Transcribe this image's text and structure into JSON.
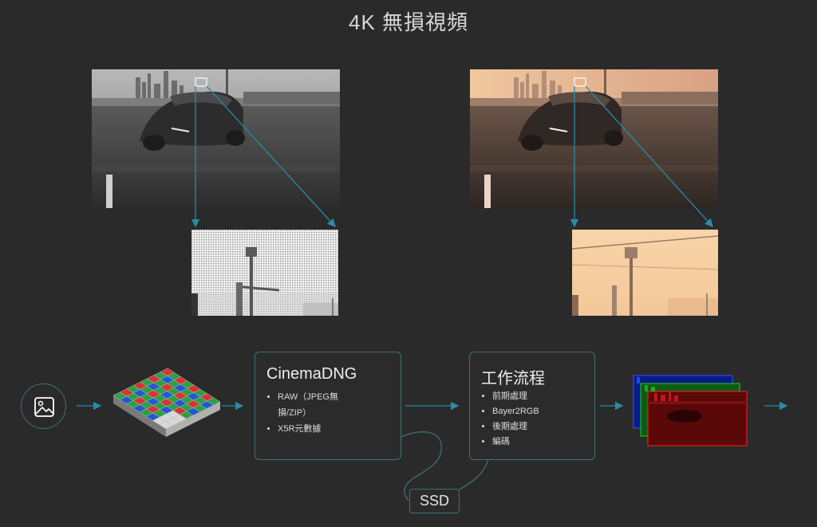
{
  "title": "4K 無損視頻",
  "colors": {
    "background": "#2a2a2a",
    "accent": "#2a8aa8",
    "card_border": "#3f6f7c"
  },
  "cinemadng": {
    "title": "CinemaDNG",
    "items": [
      "RAW（JPEG無損/ZIP）",
      "X5R元數據"
    ]
  },
  "workflow": {
    "title": "工作流程",
    "items": [
      "前期處理",
      "Bayer2RGB",
      "後期處理",
      "編碼"
    ]
  },
  "ssd_label": "SSD",
  "icons": {
    "image": "image-icon",
    "bayer": "bayer-sensor-icon",
    "rgb": "rgb-channel-stack-icon"
  }
}
